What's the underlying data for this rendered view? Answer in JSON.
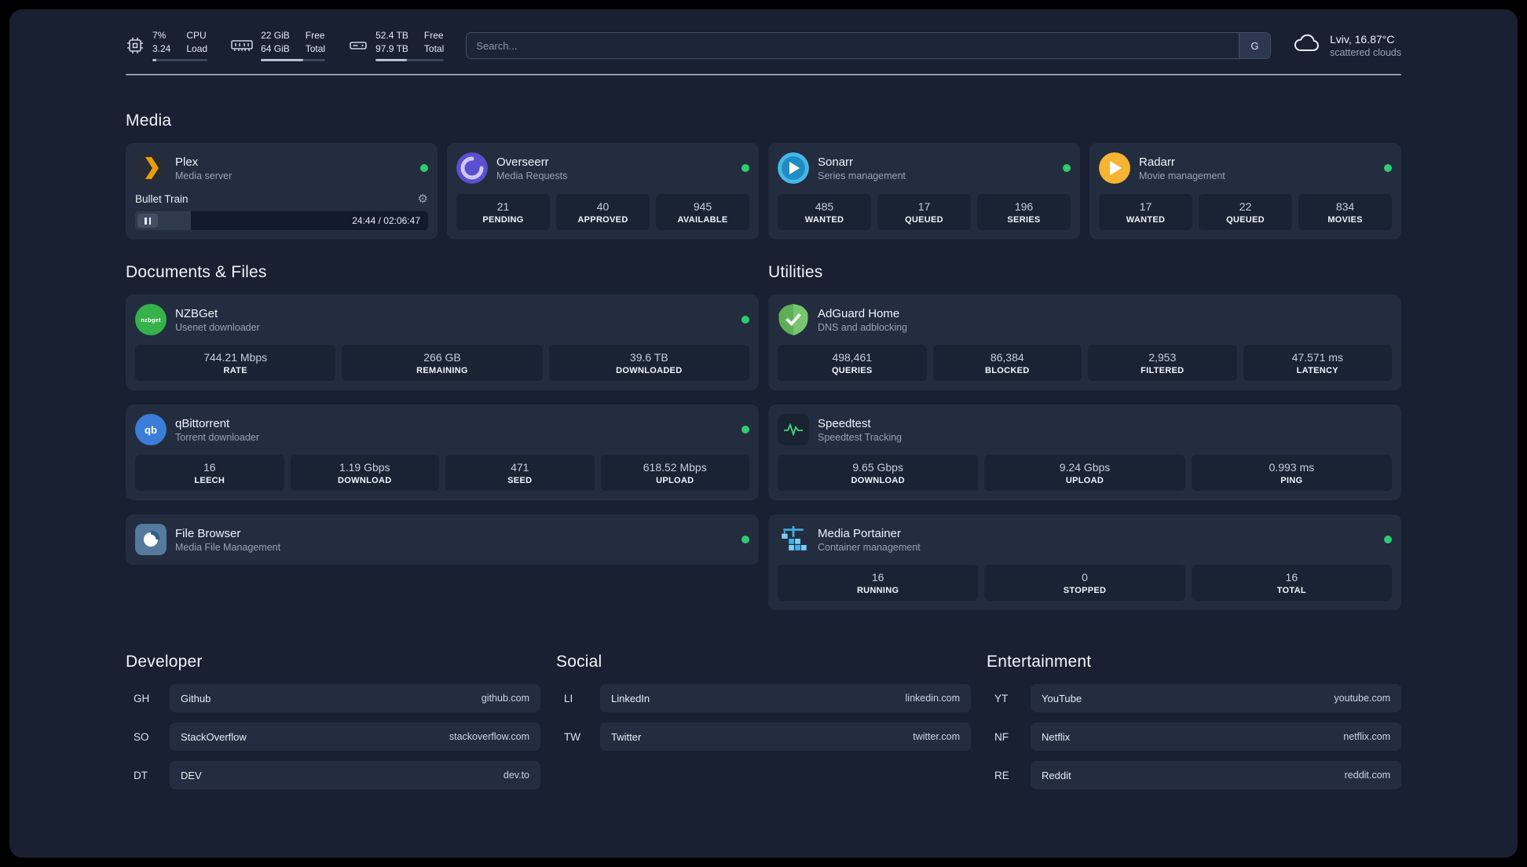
{
  "colors": {
    "status_online": "#2fcb6f",
    "plex_accent": "#e5a00d"
  },
  "topbar": {
    "cpu": {
      "icon": "cpu-icon",
      "percent": "7%",
      "load": "3.24",
      "label_top": "CPU",
      "label_bottom": "Load"
    },
    "memory": {
      "icon": "ram-icon",
      "free": "22 GiB",
      "total": "64 GiB",
      "label_top": "Free",
      "label_bottom": "Total"
    },
    "disk": {
      "icon": "disk-icon",
      "free": "52.4 TB",
      "total": "97.9 TB",
      "label_top": "Free",
      "label_bottom": "Total"
    },
    "search": {
      "placeholder": "Search...",
      "engine": "G"
    },
    "weather": {
      "icon": "cloud-icon",
      "location": "Lviv, 16.87°C",
      "condition": "scattered clouds"
    }
  },
  "sections": {
    "media": "Media",
    "documents": "Documents & Files",
    "utilities": "Utilities",
    "developer": "Developer",
    "social": "Social",
    "entertainment": "Entertainment"
  },
  "services": {
    "plex": {
      "icon": "plex-icon",
      "name": "Plex",
      "subtitle": "Media server",
      "now_playing": "Bullet Train",
      "time": "24:44 / 02:06:47"
    },
    "overseerr": {
      "icon": "overseerr-icon",
      "name": "Overseerr",
      "subtitle": "Media Requests",
      "stats": [
        {
          "value": "21",
          "label": "PENDING"
        },
        {
          "value": "40",
          "label": "APPROVED"
        },
        {
          "value": "945",
          "label": "AVAILABLE"
        }
      ]
    },
    "sonarr": {
      "icon": "sonarr-icon",
      "name": "Sonarr",
      "subtitle": "Series management",
      "stats": [
        {
          "value": "485",
          "label": "WANTED"
        },
        {
          "value": "17",
          "label": "QUEUED"
        },
        {
          "value": "196",
          "label": "SERIES"
        }
      ]
    },
    "radarr": {
      "icon": "radarr-icon",
      "name": "Radarr",
      "subtitle": "Movie management",
      "stats": [
        {
          "value": "17",
          "label": "WANTED"
        },
        {
          "value": "22",
          "label": "QUEUED"
        },
        {
          "value": "834",
          "label": "MOVIES"
        }
      ]
    },
    "nzbget": {
      "icon": "nzbget-icon",
      "icon_text": "nzbget",
      "name": "NZBGet",
      "subtitle": "Usenet downloader",
      "stats": [
        {
          "value": "744.21 Mbps",
          "label": "RATE"
        },
        {
          "value": "266 GB",
          "label": "REMAINING"
        },
        {
          "value": "39.6 TB",
          "label": "DOWNLOADED"
        }
      ]
    },
    "qbittorrent": {
      "icon": "qbittorrent-icon",
      "icon_text": "qb",
      "name": "qBittorrent",
      "subtitle": "Torrent downloader",
      "stats": [
        {
          "value": "16",
          "label": "LEECH"
        },
        {
          "value": "1.19 Gbps",
          "label": "DOWNLOAD"
        },
        {
          "value": "471",
          "label": "SEED"
        },
        {
          "value": "618.52 Mbps",
          "label": "UPLOAD"
        }
      ]
    },
    "filebrowser": {
      "icon": "filebrowser-icon",
      "name": "File Browser",
      "subtitle": "Media File Management"
    },
    "adguard": {
      "icon": "adguard-icon",
      "name": "AdGuard Home",
      "subtitle": "DNS and adblocking",
      "stats": [
        {
          "value": "498,461",
          "label": "QUERIES"
        },
        {
          "value": "86,384",
          "label": "BLOCKED"
        },
        {
          "value": "2,953",
          "label": "FILTERED"
        },
        {
          "value": "47.571 ms",
          "label": "LATENCY"
        }
      ]
    },
    "speedtest": {
      "icon": "speedtest-icon",
      "name": "Speedtest",
      "subtitle": "Speedtest Tracking",
      "stats": [
        {
          "value": "9.65 Gbps",
          "label": "DOWNLOAD"
        },
        {
          "value": "9.24 Gbps",
          "label": "UPLOAD"
        },
        {
          "value": "0.993 ms",
          "label": "PING"
        }
      ]
    },
    "portainer": {
      "icon": "portainer-icon",
      "name": "Media Portainer",
      "subtitle": "Container management",
      "stats": [
        {
          "value": "16",
          "label": "RUNNING"
        },
        {
          "value": "0",
          "label": "STOPPED"
        },
        {
          "value": "16",
          "label": "TOTAL"
        }
      ]
    }
  },
  "links": {
    "developer": [
      {
        "abbr": "GH",
        "name": "Github",
        "url": "github.com"
      },
      {
        "abbr": "SO",
        "name": "StackOverflow",
        "url": "stackoverflow.com"
      },
      {
        "abbr": "DT",
        "name": "DEV",
        "url": "dev.to"
      }
    ],
    "social": [
      {
        "abbr": "LI",
        "name": "LinkedIn",
        "url": "linkedin.com"
      },
      {
        "abbr": "TW",
        "name": "Twitter",
        "url": "twitter.com"
      }
    ],
    "entertainment": [
      {
        "abbr": "YT",
        "name": "YouTube",
        "url": "youtube.com"
      },
      {
        "abbr": "NF",
        "name": "Netflix",
        "url": "netflix.com"
      },
      {
        "abbr": "RE",
        "name": "Reddit",
        "url": "reddit.com"
      }
    ]
  }
}
